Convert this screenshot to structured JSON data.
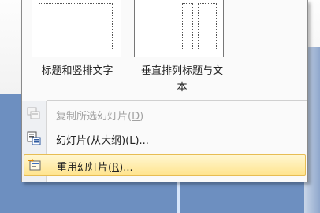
{
  "layouts": [
    {
      "caption_line1": "标题和竖排文字",
      "caption_line2": ""
    },
    {
      "caption_line1": "垂直排列标题与文",
      "caption_line2": "本"
    }
  ],
  "menu": {
    "items": [
      {
        "label_pre": "复制所选幻灯片(",
        "key": "D",
        "label_post": ")",
        "icon": "duplicate-slide-icon",
        "state": "disabled"
      },
      {
        "label_pre": "幻灯片(从大纲)(",
        "key": "L",
        "label_post": ")...",
        "icon": "slides-from-outline-icon",
        "state": "normal"
      },
      {
        "label_pre": "重用幻灯片(",
        "key": "R",
        "label_post": ")...",
        "icon": "reuse-slides-icon",
        "state": "highlighted"
      }
    ]
  },
  "colors": {
    "highlight": "#ffe48e",
    "background": "#6d8fc0"
  }
}
